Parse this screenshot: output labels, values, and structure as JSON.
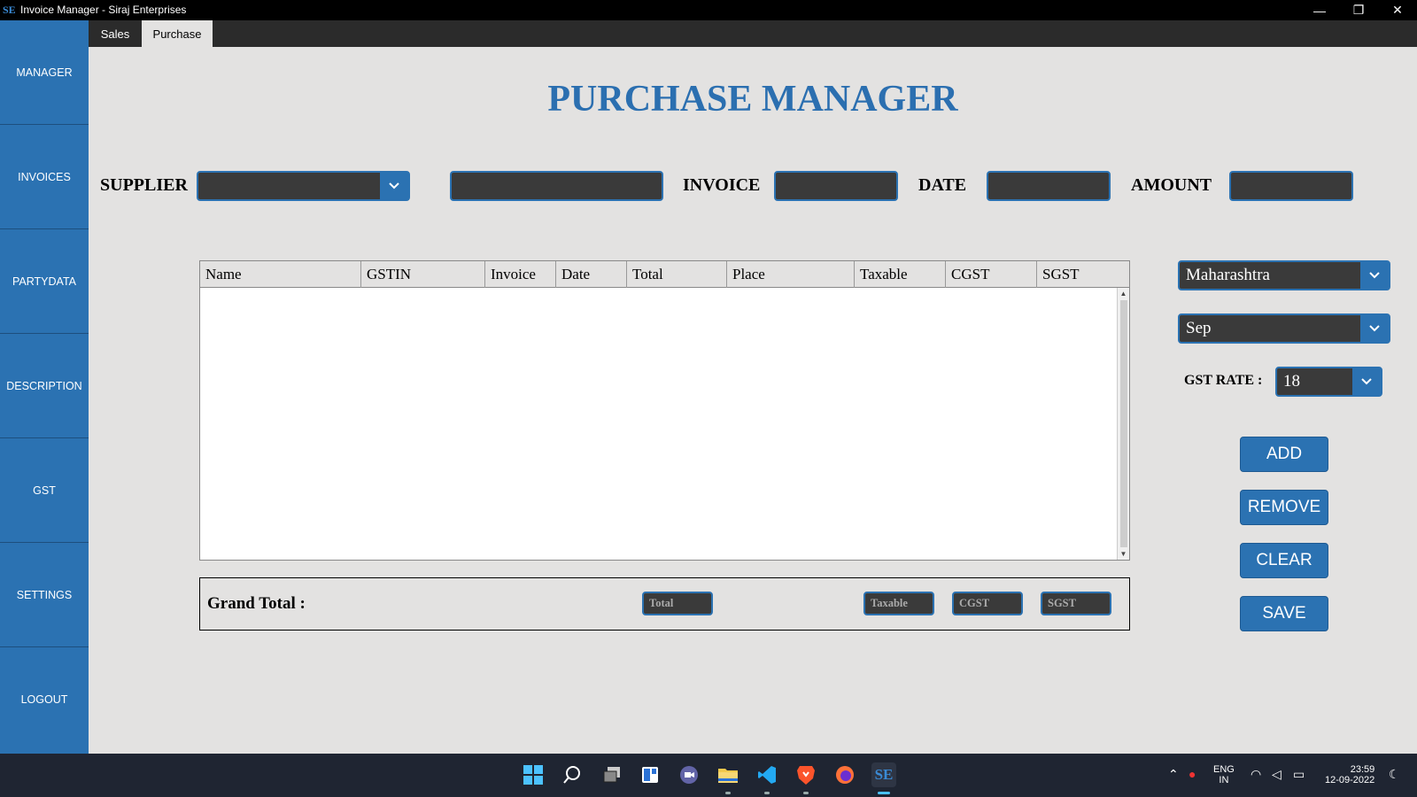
{
  "window": {
    "title": "Invoice Manager - Siraj Enterprises",
    "app_icon_text": "SE",
    "minimize_glyph": "—",
    "restore_glyph": "❐",
    "close_glyph": "✕"
  },
  "sidebar": {
    "items": [
      {
        "label": "MANAGER"
      },
      {
        "label": "INVOICES"
      },
      {
        "label": "PARTYDATA"
      },
      {
        "label": "DESCRIPTION"
      },
      {
        "label": "GST"
      },
      {
        "label": "SETTINGS"
      },
      {
        "label": "LOGOUT"
      }
    ]
  },
  "tabs": {
    "sales": "Sales",
    "purchase": "Purchase",
    "active": "Purchase"
  },
  "heading": "PURCHASE MANAGER",
  "form": {
    "supplier_label": "SUPPLIER",
    "supplier_value": "",
    "gstin_value": "",
    "invoice_label": "INVOICE",
    "invoice_value": "",
    "date_label": "DATE",
    "date_value": "",
    "amount_label": "AMOUNT",
    "amount_value": ""
  },
  "table": {
    "columns": [
      "Name",
      "GSTIN",
      "Invoice",
      "Date",
      "Total",
      "Place",
      "Taxable",
      "CGST",
      "SGST"
    ],
    "rows": []
  },
  "grand_total": {
    "label": "Grand Total :",
    "total_placeholder": "Total",
    "taxable_placeholder": "Taxable",
    "cgst_placeholder": "CGST",
    "sgst_placeholder": "SGST"
  },
  "right_panel": {
    "state_value": "Maharashtra",
    "month_value": "Sep",
    "gst_rate_label": "GST RATE :",
    "gst_rate_value": "18",
    "add_label": "ADD",
    "remove_label": "REMOVE",
    "clear_label": "CLEAR",
    "save_label": "SAVE"
  },
  "taskbar": {
    "language_top": "ENG",
    "language_bottom": "IN",
    "time": "23:59",
    "date": "12-09-2022",
    "pinned": [
      "start-icon",
      "search-icon",
      "task-view-icon",
      "widgets-icon",
      "chat-icon",
      "file-explorer-icon",
      "vscode-icon",
      "brave-icon",
      "firefox-icon",
      "invoice-manager-icon"
    ]
  },
  "colors": {
    "accent": "#2b72b2",
    "heading": "#2b6fb0",
    "field_bg": "#3a3a3a",
    "page_bg": "#e3e2e1"
  }
}
